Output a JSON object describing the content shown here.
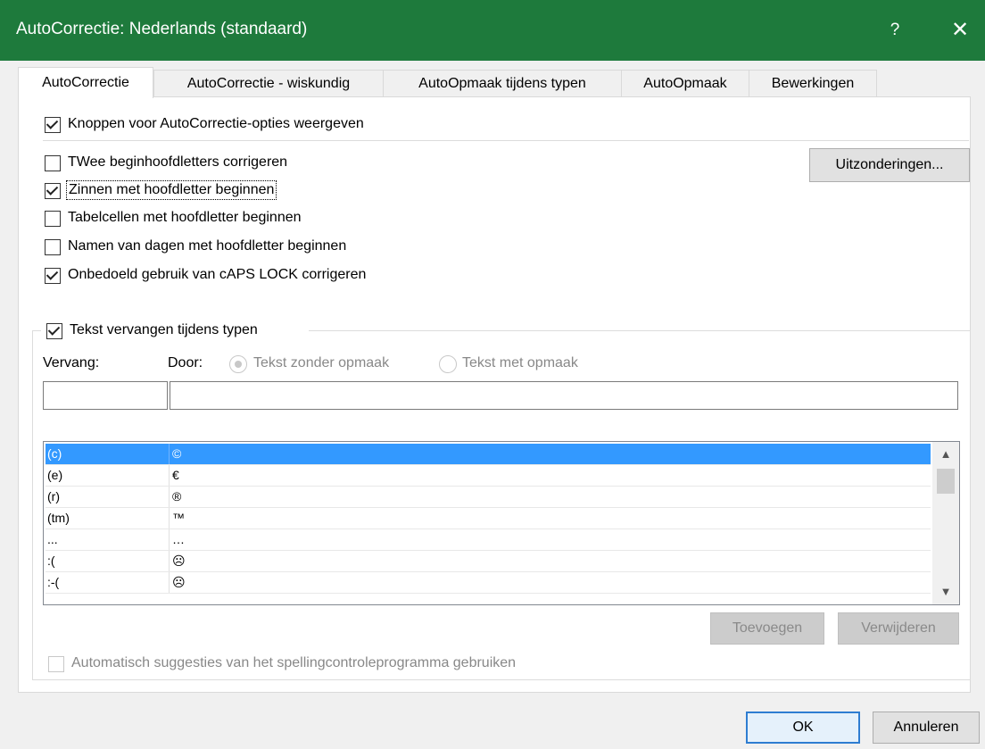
{
  "window": {
    "title": "AutoCorrectie: Nederlands (standaard)",
    "help": "?",
    "close": "✕"
  },
  "tabs": [
    {
      "label": "AutoCorrectie"
    },
    {
      "label": "AutoCorrectie - wiskundig"
    },
    {
      "label": "AutoOpmaak tijdens typen"
    },
    {
      "label": "AutoOpmaak"
    },
    {
      "label": "Bewerkingen"
    }
  ],
  "options": {
    "show_buttons": {
      "label": "Knoppen voor AutoCorrectie-opties weergeven",
      "checked": true
    },
    "two_initials": {
      "label": "TWee beginhoofdletters corrigeren",
      "checked": false
    },
    "sentences": {
      "label": "Zinnen met hoofdletter beginnen",
      "checked": true
    },
    "table_cells": {
      "label": "Tabelcellen met hoofdletter beginnen",
      "checked": false
    },
    "day_names": {
      "label": "Namen van dagen met hoofdletter beginnen",
      "checked": false
    },
    "caps_lock": {
      "label": "Onbedoeld gebruik van cAPS LOCK corrigeren",
      "checked": true
    }
  },
  "exceptions_button": "Uitzonderingen...",
  "replace": {
    "enabled_label": "Tekst vervangen tijdens typen",
    "checked": true,
    "vervang_label": "Vervang:",
    "door_label": "Door:",
    "radio_plain": "Tekst zonder opmaak",
    "radio_formatted": "Tekst met opmaak",
    "vervang_value": "",
    "door_value": ""
  },
  "entries": [
    {
      "from": "(c)",
      "to": "©"
    },
    {
      "from": "(e)",
      "to": "€"
    },
    {
      "from": "(r)",
      "to": "®"
    },
    {
      "from": "(tm)",
      "to": "™"
    },
    {
      "from": "...",
      "to": "…"
    },
    {
      "from": ":(",
      "to": "☹"
    },
    {
      "from": ":-(",
      "to": "☹"
    }
  ],
  "buttons": {
    "add": "Toevoegen",
    "delete": "Verwijderen",
    "ok": "OK",
    "cancel": "Annuleren"
  },
  "spelling_suggestions": {
    "label": "Automatisch suggesties van het spellingcontroleprogramma gebruiken",
    "checked": false
  }
}
